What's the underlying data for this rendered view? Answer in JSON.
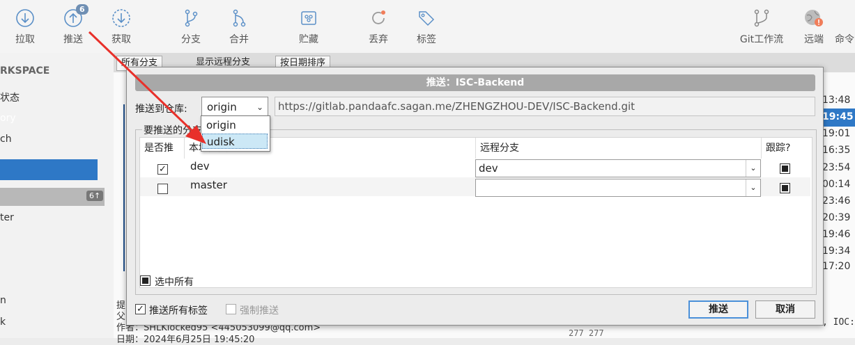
{
  "toolbar": {
    "commit": "拉取",
    "push": "推送",
    "push_badge": "6",
    "fetch": "获取",
    "branch": "分支",
    "merge": "合并",
    "stash": "贮藏",
    "discard": "丢弃",
    "tag": "标签",
    "gitflow": "Git工作流",
    "remote": "远端",
    "terminal": "命令"
  },
  "sidebar": {
    "workspace": "RKSPACE",
    "item1": "状态",
    "item2": "ory",
    "item3": "ch",
    "badge": "6↑",
    "item4": "ter",
    "item5": "n",
    "item6": "k"
  },
  "filterbar": {
    "branches": "所有分支",
    "show_remote": "显示远程分支",
    "sort": "按日期排序"
  },
  "times": [
    "13:48",
    "19:45",
    "19:01",
    "16:35",
    "23:54",
    "00:14",
    "23:46",
    "20:39",
    "19:46",
    "19:34",
    "17:20"
  ],
  "bottom": {
    "line1": "提",
    "line2": "父",
    "author": "作者：SHLKlocked95 <445053099@qq.com>",
    "date": "日期：2024年6月25日 19:45:20",
    "code": ", IOC:",
    "linenum": "277  277"
  },
  "dialog": {
    "title": "推送：ISC-Backend",
    "push_to_label": "推送到仓库:",
    "repo_selected": "origin",
    "repo_url": "https://gitlab.pandaafc.sagan.me/ZHENGZHOU-DEV/ISC-Backend.git",
    "repo_options": [
      "origin",
      "udisk"
    ],
    "branches_legend": "要推送的分支",
    "columns": {
      "push": "是否推",
      "local": "本地分支",
      "remote": "远程分支",
      "track": "跟踪?"
    },
    "rows": [
      {
        "push": true,
        "local": "dev",
        "remote": "dev",
        "track": true
      },
      {
        "push": false,
        "local": "master",
        "remote": "",
        "track": true
      }
    ],
    "select_all": "选中所有",
    "push_all_tags": "推送所有标签",
    "force_push": "强制推送",
    "ok": "推送",
    "cancel": "取消"
  }
}
